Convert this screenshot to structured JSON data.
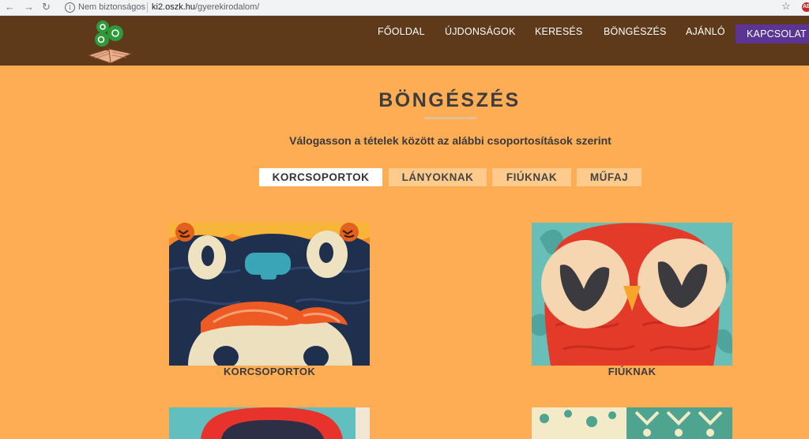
{
  "browser": {
    "security_label": "Nem biztonságos",
    "url_host": "ki2.oszk.hu",
    "url_path": "/gyerekirodalom/",
    "extension_badge": "AB"
  },
  "nav": {
    "items": [
      "FŐOLDAL",
      "ÚJDONSÁGOK",
      "KERESÉS",
      "BÖNGÉSZÉS",
      "AJÁNLÓ"
    ],
    "contact": "KAPCSOLAT"
  },
  "page": {
    "title": "BÖNGÉSZÉS",
    "subtitle": "Válogasson a tételek között az alábbi csoportosítások szerint"
  },
  "tabs": [
    {
      "label": "KORCSOPORTOK",
      "active": true
    },
    {
      "label": "LÁNYOKNAK",
      "active": false
    },
    {
      "label": "FIÚKNAK",
      "active": false
    },
    {
      "label": "MŰFAJ",
      "active": false
    }
  ],
  "cards": [
    {
      "label": "KORCSOPORTOK"
    },
    {
      "label": "FIÚKNAK"
    }
  ],
  "colors": {
    "header_bg": "#5E3A1A",
    "page_bg": "#FFAD55",
    "contact_bg": "#5B3596",
    "tab_bg": "#FFCB8C"
  }
}
